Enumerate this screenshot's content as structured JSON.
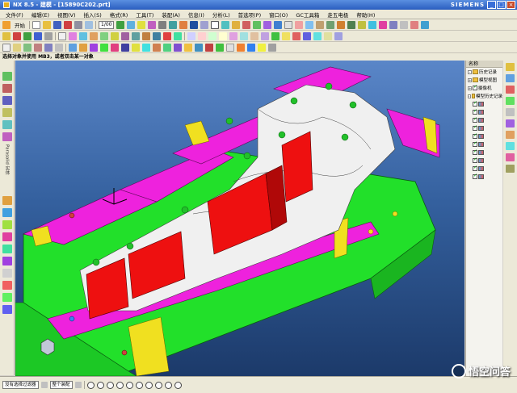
{
  "window": {
    "title": "NX 8.5 - 建模 - [15890C202.prt]",
    "brand": "SIEMENS",
    "controls": [
      "_",
      "□",
      "×"
    ]
  },
  "menu": {
    "items": [
      "文件(F)",
      "编辑(E)",
      "视图(V)",
      "插入(S)",
      "格式(R)",
      "工具(T)",
      "装配(A)",
      "信息(I)",
      "分析(L)",
      "首选项(P)",
      "窗口(O)",
      "GC工具箱",
      "走五电极",
      "帮助(H)"
    ]
  },
  "toolbar": {
    "start_label": "开始",
    "view_combo": "1/00",
    "filter_text": "选择对象并使用 MB3，或者双击某一对象"
  },
  "left_toolbar": {
    "vertical_label": "Parasolid 实体"
  },
  "navigator": {
    "header": "名称",
    "rows": [
      {
        "label": "历史记录",
        "expanded": true,
        "checked": false
      },
      {
        "label": "模型视图",
        "expanded": true,
        "checked": false
      },
      {
        "label": "摄像机",
        "expanded": true,
        "checked": true
      },
      {
        "label": "模型历史记录",
        "expanded": true,
        "checked": false
      },
      {
        "label": "",
        "expanded": false,
        "checked": true
      },
      {
        "label": "",
        "expanded": false,
        "checked": true
      },
      {
        "label": "",
        "expanded": false,
        "checked": true
      },
      {
        "label": "",
        "expanded": false,
        "checked": true
      },
      {
        "label": "",
        "expanded": false,
        "checked": true
      },
      {
        "label": "",
        "expanded": false,
        "checked": true
      },
      {
        "label": "",
        "expanded": false,
        "checked": true
      },
      {
        "label": "",
        "expanded": false,
        "checked": true
      },
      {
        "label": "",
        "expanded": false,
        "checked": true
      },
      {
        "label": "",
        "expanded": false,
        "checked": true
      }
    ]
  },
  "statusbar": {
    "filter": "没有选择过滤器",
    "assembly": "整个装配"
  },
  "watermark": {
    "text": "悟空问答"
  },
  "colors": {
    "face_green": "#22e02a",
    "face_magenta": "#ee22dd",
    "face_red": "#ee1010",
    "face_yellow": "#f0e020",
    "face_white": "#f0f0f0",
    "viewport_top": "#5a86c8",
    "viewport_bottom": "#1c3a6a"
  }
}
